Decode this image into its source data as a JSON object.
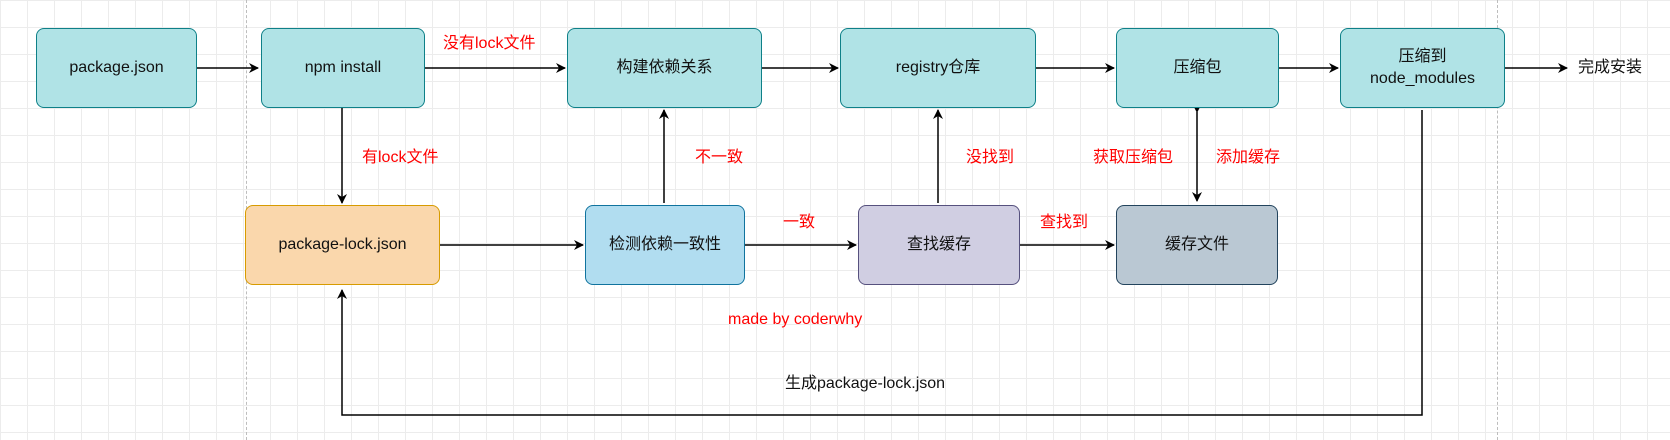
{
  "nodes": {
    "package_json": "package.json",
    "npm_install": "npm install",
    "build_deps": "构建依赖关系",
    "registry": "registry仓库",
    "compress": "压缩包",
    "to_node_modules": "压缩到\nnode_modules",
    "lock_json": "package-lock.json",
    "check_consistency": "检测依赖一致性",
    "find_cache": "查找缓存",
    "cache_file": "缓存文件"
  },
  "labels": {
    "no_lock": "没有lock文件",
    "has_lock": "有lock文件",
    "inconsistent": "不一致",
    "consistent": "一致",
    "not_found": "没找到",
    "found": "查找到",
    "get_package": "获取压缩包",
    "add_cache": "添加缓存",
    "install_done": "完成安装",
    "generate_lock": "生成package-lock.json",
    "credit": "made by coderwhy"
  },
  "colors": {
    "teal": "#b0e3e6",
    "orange": "#fad7ac",
    "blue": "#b1ddf0",
    "purple": "#d0cee2",
    "gray": "#bac8d3",
    "label_red": "#ff0000"
  }
}
